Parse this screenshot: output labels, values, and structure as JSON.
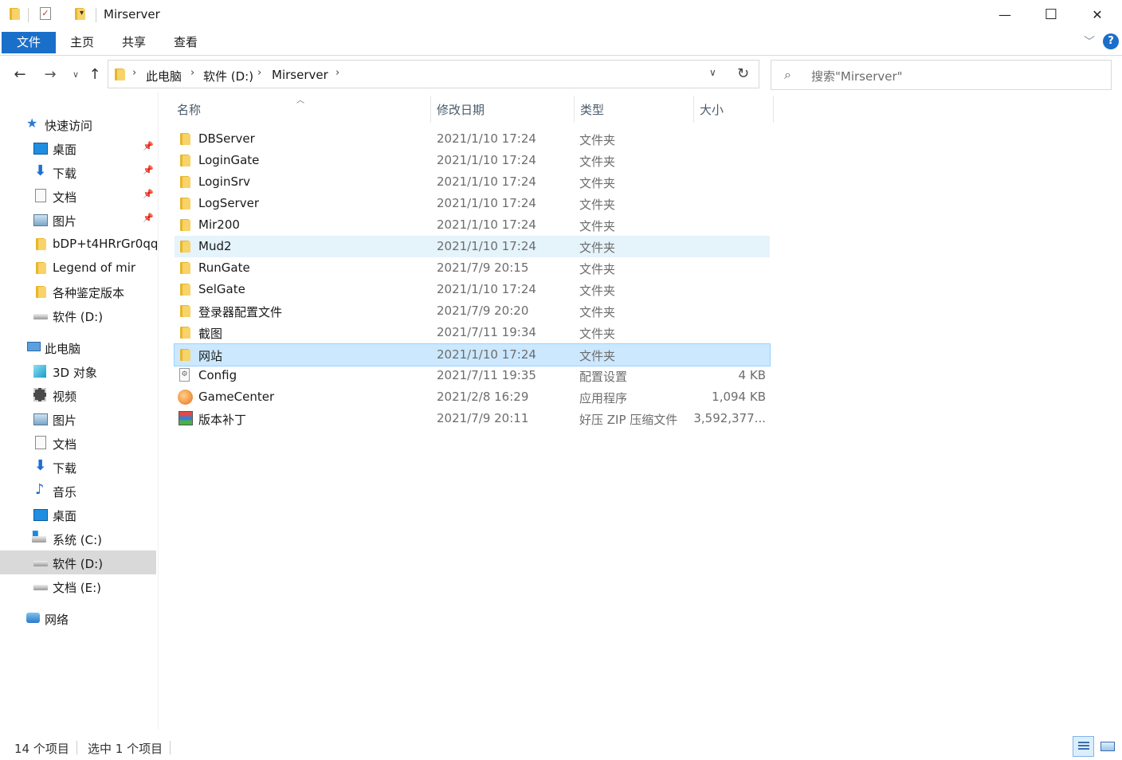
{
  "window": {
    "title": "Mirserver",
    "minimize_glyph": "—",
    "maximize_glyph": "☐",
    "close_glyph": "✕"
  },
  "ribbon": {
    "tabs": [
      "文件",
      "主页",
      "共享",
      "查看"
    ],
    "help_glyph": "?"
  },
  "address": {
    "crumbs": [
      "此电脑",
      "软件 (D:)",
      "Mirserver"
    ],
    "search_placeholder": "搜索\"Mirserver\""
  },
  "sidebar": {
    "quick_access": "快速访问",
    "quick_items": [
      {
        "label": "桌面",
        "icon": "desktop-icon"
      },
      {
        "label": "下载",
        "icon": "download-icon"
      },
      {
        "label": "文档",
        "icon": "document-icon"
      },
      {
        "label": "图片",
        "icon": "picture-icon"
      },
      {
        "label": "bDP+t4HRrGr0qq",
        "icon": "folder-icon"
      },
      {
        "label": "Legend of mir",
        "icon": "folder-icon"
      },
      {
        "label": "各种鉴定版本",
        "icon": "folder-icon"
      },
      {
        "label": "软件 (D:)",
        "icon": "drive-icon"
      }
    ],
    "this_pc": "此电脑",
    "pc_items": [
      {
        "label": "3D 对象",
        "icon": "3d-objects-icon"
      },
      {
        "label": "视频",
        "icon": "video-icon"
      },
      {
        "label": "图片",
        "icon": "picture-icon"
      },
      {
        "label": "文档",
        "icon": "document-icon"
      },
      {
        "label": "下载",
        "icon": "download-icon"
      },
      {
        "label": "音乐",
        "icon": "music-icon"
      },
      {
        "label": "桌面",
        "icon": "desktop-icon"
      },
      {
        "label": "系统 (C:)",
        "icon": "system-drive-icon"
      },
      {
        "label": "软件 (D:)",
        "icon": "drive-icon"
      },
      {
        "label": "文档 (E:)",
        "icon": "drive-icon"
      }
    ],
    "network": "网络"
  },
  "list": {
    "headers": {
      "name": "名称",
      "date": "修改日期",
      "type": "类型",
      "size": "大小"
    },
    "rows": [
      {
        "name": "DBServer",
        "date": "2021/1/10 17:24",
        "type": "文件夹",
        "size": "",
        "icon": "folder-icon"
      },
      {
        "name": "LoginGate",
        "date": "2021/1/10 17:24",
        "type": "文件夹",
        "size": "",
        "icon": "folder-icon"
      },
      {
        "name": "LoginSrv",
        "date": "2021/1/10 17:24",
        "type": "文件夹",
        "size": "",
        "icon": "folder-icon"
      },
      {
        "name": "LogServer",
        "date": "2021/1/10 17:24",
        "type": "文件夹",
        "size": "",
        "icon": "folder-icon"
      },
      {
        "name": "Mir200",
        "date": "2021/1/10 17:24",
        "type": "文件夹",
        "size": "",
        "icon": "folder-icon"
      },
      {
        "name": "Mud2",
        "date": "2021/1/10 17:24",
        "type": "文件夹",
        "size": "",
        "icon": "folder-icon"
      },
      {
        "name": "RunGate",
        "date": "2021/7/9 20:15",
        "type": "文件夹",
        "size": "",
        "icon": "folder-icon"
      },
      {
        "name": "SelGate",
        "date": "2021/1/10 17:24",
        "type": "文件夹",
        "size": "",
        "icon": "folder-icon"
      },
      {
        "name": "登录器配置文件",
        "date": "2021/7/9 20:20",
        "type": "文件夹",
        "size": "",
        "icon": "folder-icon"
      },
      {
        "name": "截图",
        "date": "2021/7/11 19:34",
        "type": "文件夹",
        "size": "",
        "icon": "folder-icon"
      },
      {
        "name": "网站",
        "date": "2021/1/10 17:24",
        "type": "文件夹",
        "size": "",
        "icon": "folder-icon"
      },
      {
        "name": "Config",
        "date": "2021/7/11 19:35",
        "type": "配置设置",
        "size": "4 KB",
        "icon": "config-file-icon"
      },
      {
        "name": "GameCenter",
        "date": "2021/2/8 16:29",
        "type": "应用程序",
        "size": "1,094 KB",
        "icon": "app-icon"
      },
      {
        "name": "版本补丁",
        "date": "2021/7/9 20:11",
        "type": "好压 ZIP 压缩文件",
        "size": "3,592,377...",
        "icon": "zip-archive-icon"
      }
    ]
  },
  "status": {
    "item_count": "14 个项目",
    "selected": "选中 1 个项目"
  },
  "colors": {
    "accent": "#1a6fc9",
    "selected_row": "#cce8ff",
    "hover_row": "#e5f3fb",
    "folder": "#f7d36a"
  }
}
